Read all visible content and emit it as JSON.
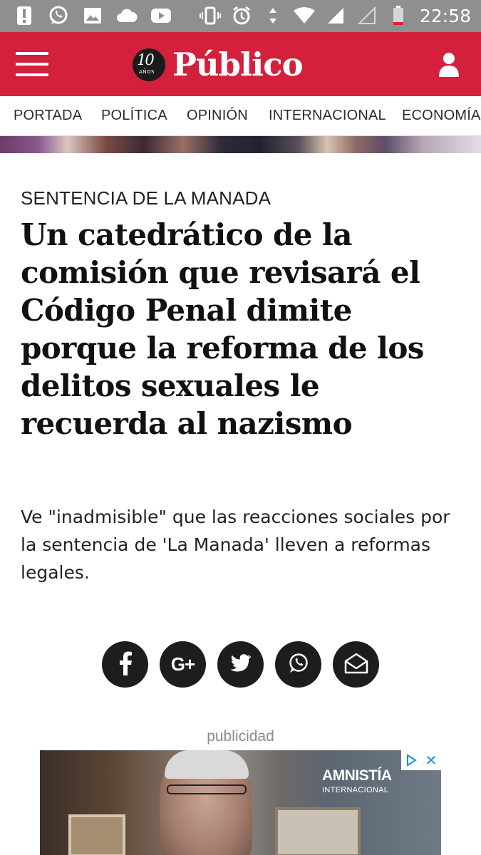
{
  "status_bar": {
    "time": "22:58",
    "left_icons": [
      "alert-icon",
      "whatsapp-notification-icon",
      "gallery-icon",
      "cloud-icon",
      "youtube-icon"
    ],
    "right_icons": [
      "vibrate-icon",
      "alarm-icon",
      "data-arrows-icon",
      "wifi-icon",
      "signal-icon",
      "signal-empty-icon",
      "battery-low-icon"
    ]
  },
  "header": {
    "logo_badge_number": "10",
    "logo_badge_text": "AÑOS",
    "logo_text": "Público",
    "background_color": "#d3203d",
    "menu_icon": "hamburger-menu-icon",
    "user_icon": "user-icon"
  },
  "nav": {
    "items": [
      {
        "label": "PORTADA"
      },
      {
        "label": "POLÍTICA"
      },
      {
        "label": "OPINIÓN"
      },
      {
        "label": "INTERNACIONAL"
      },
      {
        "label": "ECONOMÍA"
      }
    ]
  },
  "article": {
    "kicker": "SENTENCIA DE LA MANADA",
    "title": "Un catedrático de la comisión que revisará el Código Penal dimite porque la reforma de los delitos sexuales le recuerda al nazismo",
    "subtitle": "Ve \"inadmisible\" que las reacciones sociales por la sentencia de 'La Manada' lleven a reformas legales."
  },
  "share": {
    "buttons": [
      {
        "icon": "facebook-icon"
      },
      {
        "icon": "google-plus-icon",
        "label": "G+"
      },
      {
        "icon": "twitter-icon"
      },
      {
        "icon": "whatsapp-icon"
      },
      {
        "icon": "email-icon"
      }
    ]
  },
  "ad": {
    "label": "publicidad",
    "brand": "AMNISTÍA",
    "brand_sub": "INTERNACIONAL",
    "choices_icon": "ad-choices-icon",
    "close_label": "✕"
  }
}
